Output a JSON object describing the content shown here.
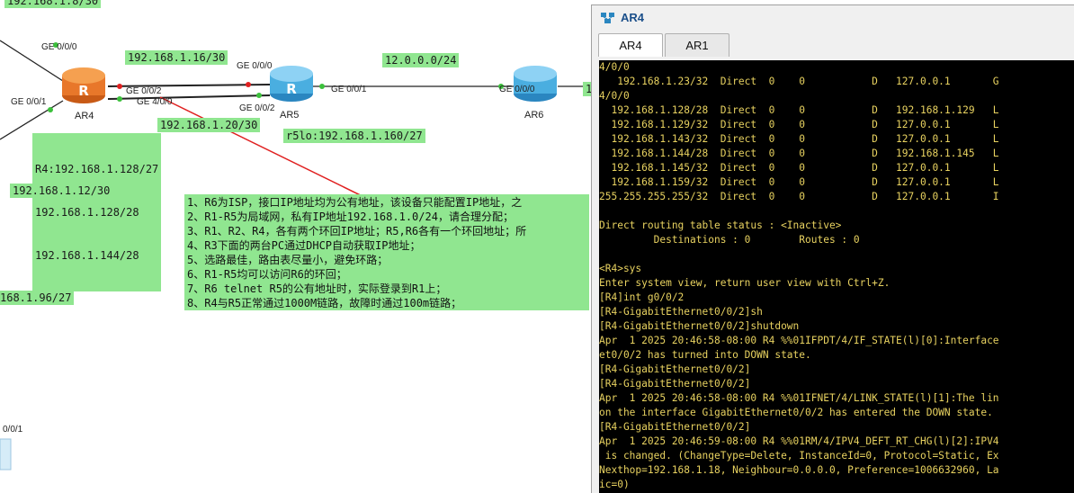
{
  "topology": {
    "labels": {
      "top_left_subnet": "192.168.1.8/30",
      "ar4_ar5_upper": "192.168.1.16/30",
      "ar5_ar6": "12.0.0.0/24",
      "ar4_ar5_lower": "192.168.1.20/30",
      "r5_loopback": "r5lo:192.168.1.160/27",
      "r4_loopbacks": [
        "R4:192.168.1.128/27",
        "192.168.1.128/28",
        "192.168.1.144/28"
      ],
      "left_subnet_12": "192.168.1.12/30",
      "left_subnet_96": "168.1.96/27",
      "right_edge_clip": "1"
    },
    "ports": {
      "ar4_ge000": "GE 0/0/0",
      "ar4_ge001": "GE 0/0/1",
      "ar4_ge002": "GE 0/0/2",
      "ar4_ge400": "GE 4/0/0",
      "ar5_ge000": "GE 0/0/0",
      "ar5_ge002": "GE 0/0/2",
      "ar5_ge001": "GE 0/0/1",
      "ar6_ge000": "GE 0/0/0",
      "bottom_device_port": "0/0/1"
    },
    "routers": {
      "ar4": "AR4",
      "ar5": "AR5",
      "ar6": "AR6"
    },
    "router_glyph": "R",
    "requirements": [
      "1、R6为ISP，接口IP地址均为公有地址，该设备只能配置IP地址，之",
      "2、R1-R5为局域网，私有IP地址192.168.1.0/24，请合理分配；",
      "3、R1、R2、R4，各有两个环回IP地址；R5,R6各有一个环回地址；所",
      "4、R3下面的两台PC通过DHCP自动获取IP地址；",
      "5、选路最佳，路由表尽量小，避免环路；",
      "6、R1-R5均可以访问R6的环回；",
      "7、R6 telnet R5的公有地址时，实际登录到R1上；",
      "8、R4与R5正常通过1000M链路，故障时通过100m链路；"
    ],
    "colors": {
      "label_bg": "#90e690",
      "arrow": "#e02020",
      "link_up": "#3cc03c",
      "link_down": "#e02020"
    }
  },
  "window": {
    "title": "AR4",
    "tabs": [
      {
        "label": "AR4",
        "active": true
      },
      {
        "label": "AR1",
        "active": false
      }
    ],
    "terminal_lines": [
      "4/0/0",
      "   192.168.1.23/32  Direct  0    0           D   127.0.0.1       G",
      "4/0/0",
      "  192.168.1.128/28  Direct  0    0           D   192.168.1.129   L",
      "  192.168.1.129/32  Direct  0    0           D   127.0.0.1       L",
      "  192.168.1.143/32  Direct  0    0           D   127.0.0.1       L",
      "  192.168.1.144/28  Direct  0    0           D   192.168.1.145   L",
      "  192.168.1.145/32  Direct  0    0           D   127.0.0.1       L",
      "  192.168.1.159/32  Direct  0    0           D   127.0.0.1       L",
      "255.255.255.255/32  Direct  0    0           D   127.0.0.1       I",
      "",
      "Direct routing table status : <Inactive>",
      "         Destinations : 0        Routes : 0",
      "",
      "<R4>sys",
      "Enter system view, return user view with Ctrl+Z.",
      "[R4]int g0/0/2",
      "[R4-GigabitEthernet0/0/2]sh",
      "[R4-GigabitEthernet0/0/2]shutdown",
      "Apr  1 2025 20:46:58-08:00 R4 %%01IFPDT/4/IF_STATE(l)[0]:Interface",
      "et0/0/2 has turned into DOWN state.",
      "[R4-GigabitEthernet0/0/2]",
      "[R4-GigabitEthernet0/0/2]",
      "Apr  1 2025 20:46:58-08:00 R4 %%01IFNET/4/LINK_STATE(l)[1]:The lin",
      "on the interface GigabitEthernet0/0/2 has entered the DOWN state.",
      "[R4-GigabitEthernet0/0/2]",
      "Apr  1 2025 20:46:59-08:00 R4 %%01RM/4/IPV4_DEFT_RT_CHG(l)[2]:IPV4",
      " is changed. (ChangeType=Delete, InstanceId=0, Protocol=Static, Ex",
      "Nexthop=192.168.1.18, Neighbour=0.0.0.0, Preference=1006632960, La",
      "ic=0)"
    ]
  }
}
